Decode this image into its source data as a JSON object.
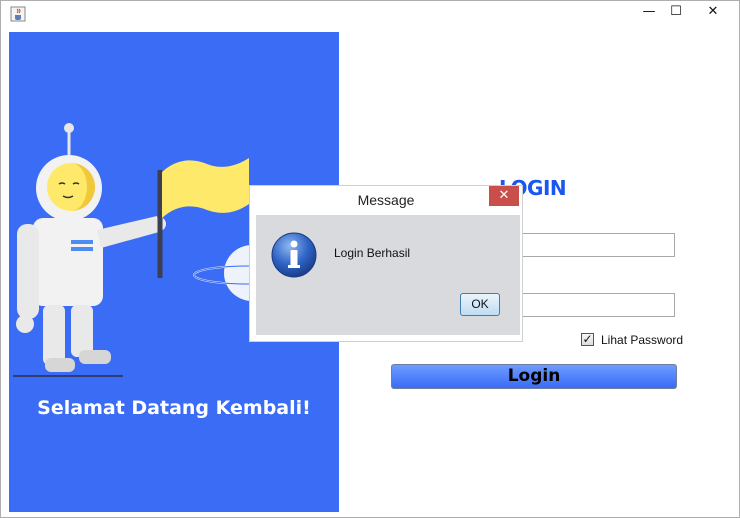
{
  "window": {
    "app_icon": "java-cup-icon",
    "controls": {
      "minimize": "—",
      "maximize": "☐",
      "close": "✕"
    }
  },
  "left_panel": {
    "welcome_text": "Selamat Datang Kembali!",
    "background_color": "#3a6cf6",
    "illustration": "astronaut-with-flag"
  },
  "login_form": {
    "title": "LOGIN",
    "username_value": "",
    "password_value": "",
    "show_password_checked": true,
    "show_password_label": "Lihat Password",
    "login_button_label": "Login",
    "accent_color": "#1a56f0"
  },
  "dialog": {
    "title": "Message",
    "close_symbol": "✕",
    "icon": "information-icon",
    "message": "Login Berhasil",
    "ok_label": "OK"
  }
}
